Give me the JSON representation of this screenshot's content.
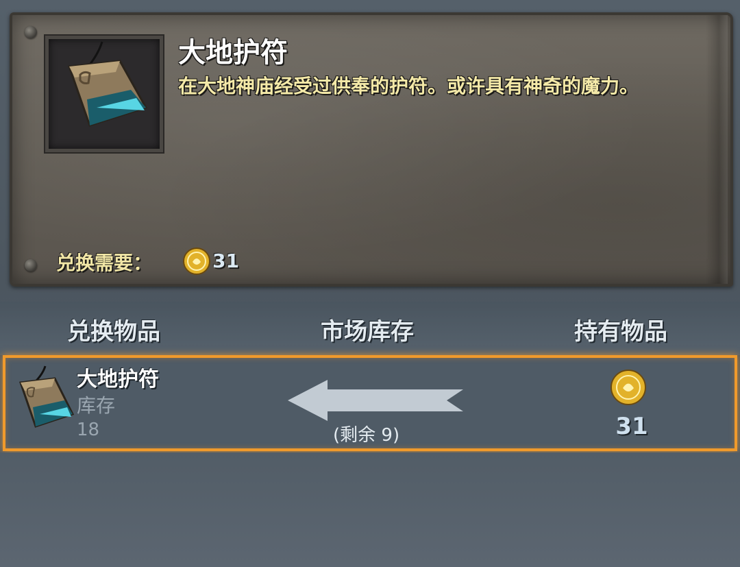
{
  "item": {
    "name": "大地护符",
    "description": "在大地神庙经受过供奉的护符。或许具有神奇的魔力。",
    "icon": "earth-amulet-icon"
  },
  "cost": {
    "label": "兑换需要：",
    "currency_icon": "gold-coin-icon",
    "value": "31"
  },
  "columns": {
    "exchange_item": "兑换物品",
    "market_stock": "市场库存",
    "owned_items": "持有物品"
  },
  "trade_row": {
    "name": "大地护符",
    "stock_label": "库存",
    "stock_value": "18",
    "remaining": "(剩余 9)",
    "price": "31",
    "arrow_icon": "left-arrow-icon"
  },
  "colors": {
    "highlight": "#f09a2c",
    "description": "#f4e9a8",
    "coin": "#e2b22a"
  }
}
